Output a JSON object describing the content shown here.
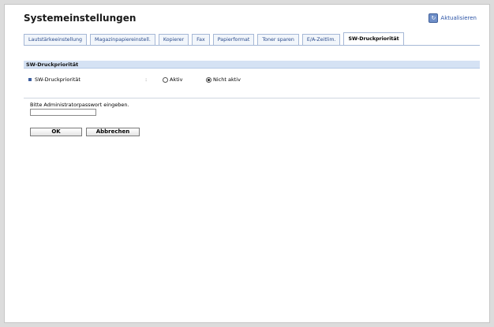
{
  "page": {
    "title": "Systemeinstellungen",
    "refresh_label": "Aktualisieren"
  },
  "tabs": [
    {
      "label": "Lautstärkeeinstellung",
      "active": false
    },
    {
      "label": "Magazinpapiereinstell.",
      "active": false
    },
    {
      "label": "Kopierer",
      "active": false
    },
    {
      "label": "Fax",
      "active": false
    },
    {
      "label": "Papierformat",
      "active": false
    },
    {
      "label": "Toner sparen",
      "active": false
    },
    {
      "label": "E/A-Zeitlim.",
      "active": false
    },
    {
      "label": "SW-Druckpriorität",
      "active": true
    }
  ],
  "section": {
    "title": "SW-Druckpriorität",
    "setting": {
      "label": "SW-Druckpriorität",
      "separator": ":",
      "options": [
        {
          "label": "Aktiv",
          "checked": false
        },
        {
          "label": "Nicht aktiv",
          "checked": true
        }
      ]
    }
  },
  "password": {
    "label": "Bitte Administratorpasswort eingeben.",
    "value": "",
    "placeholder": ""
  },
  "buttons": {
    "ok_label": "OK",
    "cancel_label": "Abbrechen"
  },
  "icons": {
    "refresh": "refresh-icon",
    "bullet": "square-bullet-icon"
  }
}
